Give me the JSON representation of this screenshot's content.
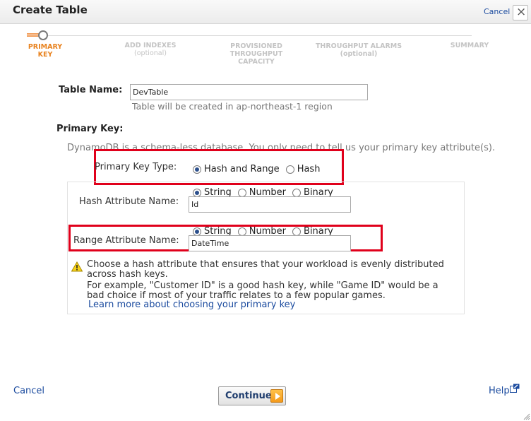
{
  "dialog": {
    "title": "Create Table",
    "close_glyph": "×",
    "cancel_top": "Cancel"
  },
  "wizard": {
    "steps": [
      {
        "label": "PRIMARY KEY",
        "sub": ""
      },
      {
        "label": "ADD INDEXES",
        "sub": "(optional)"
      },
      {
        "label": "PROVISIONED",
        "sub": "THROUGHPUT CAPACITY"
      },
      {
        "label": "THROUGHPUT ALARMS",
        "sub": "(optional)"
      },
      {
        "label": "SUMMARY",
        "sub": ""
      }
    ],
    "active_index": 0,
    "active_color": "#e8821e"
  },
  "form": {
    "table_name_label": "Table Name:",
    "table_name_value": "DevTable",
    "table_region_note": "Table will be created in ap-northeast-1 region",
    "primary_key_label": "Primary Key:",
    "schemaless_note": "DynamoDB is a schema-less database. You only need to tell us your primary key attribute(s).",
    "primary_key_type_label": "Primary Key Type:",
    "pk_type_options": [
      "Hash and Range",
      "Hash"
    ],
    "pk_type_selected": "Hash and Range",
    "hash_attr_label": "Hash Attribute Name:",
    "hash_attr_value": "Id",
    "hash_type_options": [
      "String",
      "Number",
      "Binary"
    ],
    "hash_type_selected": "String",
    "range_attr_label": "Range Attribute Name:",
    "range_attr_value": "DateTime",
    "range_type_options": [
      "String",
      "Number",
      "Binary"
    ],
    "range_type_selected": "String",
    "tip_line1": "Choose a hash attribute that ensures that your workload is evenly distributed",
    "tip_line2": "across hash keys.",
    "tip_line3": "For example, \"Customer ID\" is a good hash key, while \"Game ID\" would be a",
    "tip_line4": "bad choice if most of your traffic relates to a few popular games.",
    "learn_more": "Learn more about choosing your primary key"
  },
  "footer": {
    "cancel": "Cancel",
    "continue": "Continue",
    "help": "Help"
  },
  "colors": {
    "highlight": "#e0001b",
    "link": "#1a4a9e"
  }
}
